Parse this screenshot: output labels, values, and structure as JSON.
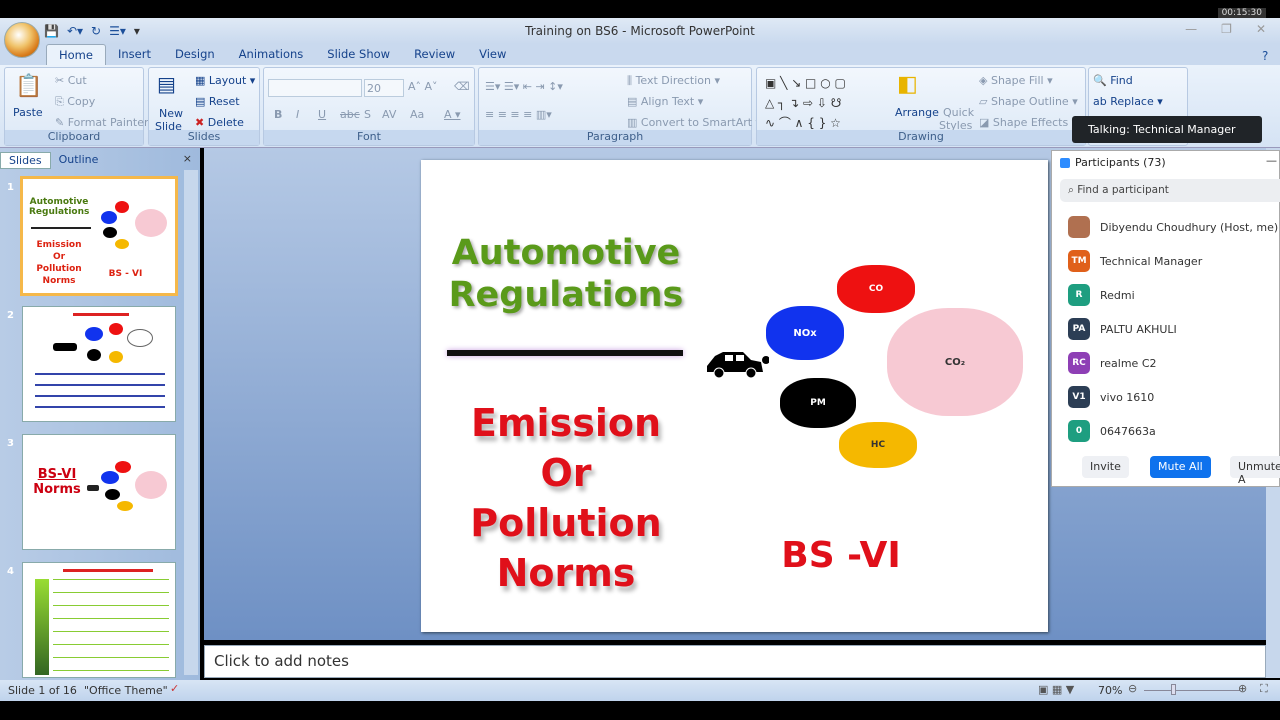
{
  "window": {
    "title": "Training on BS6 - Microsoft PowerPoint",
    "timer": "00:15:30"
  },
  "tabs": [
    "Home",
    "Insert",
    "Design",
    "Animations",
    "Slide Show",
    "Review",
    "View"
  ],
  "ribbon": {
    "clipboard": {
      "label": "Clipboard",
      "paste": "Paste",
      "cut": "Cut",
      "copy": "Copy",
      "format_painter": "Format Painter"
    },
    "slides": {
      "label": "Slides",
      "new_slide": "New",
      "new_slide2": "Slide",
      "layout": "Layout",
      "reset": "Reset",
      "delete": "Delete"
    },
    "font": {
      "label": "Font",
      "size": "20"
    },
    "paragraph": {
      "label": "Paragraph",
      "text_direction": "Text Direction",
      "align_text": "Align Text",
      "convert": "Convert to SmartArt"
    },
    "drawing": {
      "label": "Drawing",
      "arrange": "Arrange",
      "quick_styles": "Quick",
      "quick_styles2": "Styles",
      "shape_fill": "Shape Fill",
      "shape_outline": "Shape Outline",
      "shape_effects": "Shape Effects"
    },
    "editing": {
      "find": "Find",
      "replace": "Replace"
    }
  },
  "left_panel": {
    "tabs": [
      "Slides",
      "Outline"
    ],
    "thumbs": [
      "1",
      "2",
      "3",
      "4"
    ],
    "slide3_title": "BS-VI",
    "slide3_sub": "Norms",
    "slide1_a": "Automotive",
    "slide1_b": "Regulations",
    "slide1_c": "Emission",
    "slide1_d": "Or",
    "slide1_e": "Pollution",
    "slide1_f": "Norms",
    "slide1_g": "BS - VI"
  },
  "slide": {
    "title1": "Automotive",
    "title2": "Regulations",
    "body": [
      "Emission",
      "Or",
      "Pollution",
      "Norms"
    ],
    "bs": "BS -VI",
    "clouds": [
      {
        "label": "CO",
        "color": "#ee1111"
      },
      {
        "label": "NOx",
        "color": "#1133ee"
      },
      {
        "label": "CO₂",
        "color": "#f7c9d3"
      },
      {
        "label": "PM",
        "color": "#000000"
      },
      {
        "label": "HC",
        "color": "#f5b800"
      }
    ]
  },
  "notes": {
    "placeholder": "Click to add notes"
  },
  "status": {
    "slide": "Slide 1 of 16",
    "theme": "\"Office Theme\"",
    "zoom": "70%"
  },
  "tooltip": "Talking: Technical Manager",
  "participants": {
    "title": "Participants (73)",
    "search_placeholder": "Find a participant",
    "list": [
      {
        "initials": "",
        "name": "Dibyendu Choudhury (Host, me)",
        "color": "#b07050"
      },
      {
        "initials": "TM",
        "name": "Technical Manager",
        "color": "#e0601a"
      },
      {
        "initials": "R",
        "name": "Redmi",
        "color": "#1e9e80"
      },
      {
        "initials": "PA",
        "name": "PALTU AKHULI",
        "color": "#2c3e55"
      },
      {
        "initials": "RC",
        "name": "realme C2",
        "color": "#8e3fb5"
      },
      {
        "initials": "V1",
        "name": "vivo 1610",
        "color": "#2c3e55"
      },
      {
        "initials": "0",
        "name": "0647663a",
        "color": "#1e9e80"
      }
    ],
    "invite": "Invite",
    "mute_all": "Mute All",
    "unmute_all": "Unmute A"
  }
}
